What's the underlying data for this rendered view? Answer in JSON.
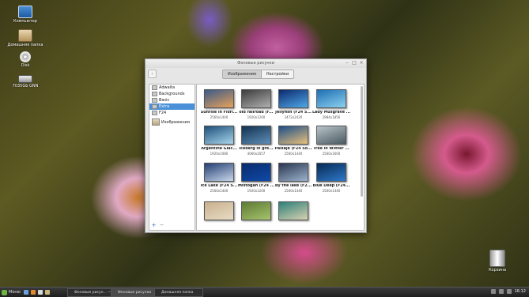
{
  "desktop": {
    "icons": [
      {
        "label": "Компьютер",
        "icon": "computer-icon"
      },
      {
        "label": "Домашняя папка",
        "icon": "home-folder-icon"
      },
      {
        "label": "Disk",
        "icon": "disc-icon"
      },
      {
        "label": "7035Gb GNN",
        "icon": "drive-icon"
      },
      {
        "label": "Корзина",
        "icon": "trash-icon"
      }
    ]
  },
  "window": {
    "title": "Фоновые рисунки",
    "tabs": [
      {
        "label": "Изображения",
        "active": true
      },
      {
        "label": "Настройки",
        "active": false
      }
    ],
    "sidebar": {
      "folders": [
        {
          "label": "Adwaita",
          "selected": false
        },
        {
          "label": "Backgrounds",
          "selected": false
        },
        {
          "label": "Basic",
          "selected": false
        },
        {
          "label": "Extra",
          "selected": true
        },
        {
          "label": "F24",
          "selected": false
        }
      ],
      "images_folder": "Изображения",
      "add_label": "+",
      "remove_label": "−"
    },
    "wallpapers": [
      {
        "name": "Sunrise in Flori...",
        "res": "2560x1440",
        "colors": [
          "#3b5a88",
          "#e6a25a"
        ]
      },
      {
        "name": "old railroad (F...",
        "res": "1920x1200",
        "colors": [
          "#3c3c3c",
          "#b0b0b0"
        ]
      },
      {
        "name": "Jellyfish (F24 S...",
        "res": "2472x2420",
        "colors": [
          "#0b2a6e",
          "#4fa8e8"
        ]
      },
      {
        "name": "Lady Musgrave ...",
        "res": "2984x1856",
        "colors": [
          "#1e6fb3",
          "#8cd1f0"
        ]
      },
      {
        "name": "Argentine Glac...",
        "res": "1920x1080",
        "colors": [
          "#1c4f7a",
          "#a8d6ec"
        ]
      },
      {
        "name": "Iceberg in gre...",
        "res": "4060x2657",
        "colors": [
          "#12304e",
          "#5f8fb8"
        ]
      },
      {
        "name": "Paisaje (F24 So...",
        "res": "2560x1440",
        "colors": [
          "#1a4d8a",
          "#e9c17a"
        ]
      },
      {
        "name": "Tree in Winter ...",
        "res": "2560x1600",
        "colors": [
          "#b8c4c8",
          "#4a5a62"
        ]
      },
      {
        "name": "Ice Lake (F24 S...",
        "res": "2560x1440",
        "colors": [
          "#243e73",
          "#c8d7ea"
        ]
      },
      {
        "name": "mistogan (F24 ...",
        "res": "1920x1200",
        "colors": [
          "#0a2b6c",
          "#0f4aa8"
        ]
      },
      {
        "name": "By the lake (F2...",
        "res": "2560x1440",
        "colors": [
          "#2a3550",
          "#9bb3cd"
        ]
      },
      {
        "name": "Blue Deep (F24...",
        "res": "2560x1440",
        "colors": [
          "#062a55",
          "#2f78c7"
        ]
      },
      {
        "name": "",
        "res": "",
        "colors": [
          "#c9b08e",
          "#e8dcc4"
        ]
      },
      {
        "name": "",
        "res": "",
        "colors": [
          "#5d7a35",
          "#a6c46b"
        ]
      },
      {
        "name": "",
        "res": "",
        "colors": [
          "#2d7f7a",
          "#d8d2b0"
        ]
      }
    ]
  },
  "taskbar": {
    "menu_label": "Меню",
    "tasks": [
      {
        "label": "Фоновые рисун... — Ne...",
        "active": false
      },
      {
        "label": "Фоновые рисунки",
        "active": true
      },
      {
        "label": "Домашняя папка",
        "active": false
      }
    ],
    "clock": "16:12"
  }
}
